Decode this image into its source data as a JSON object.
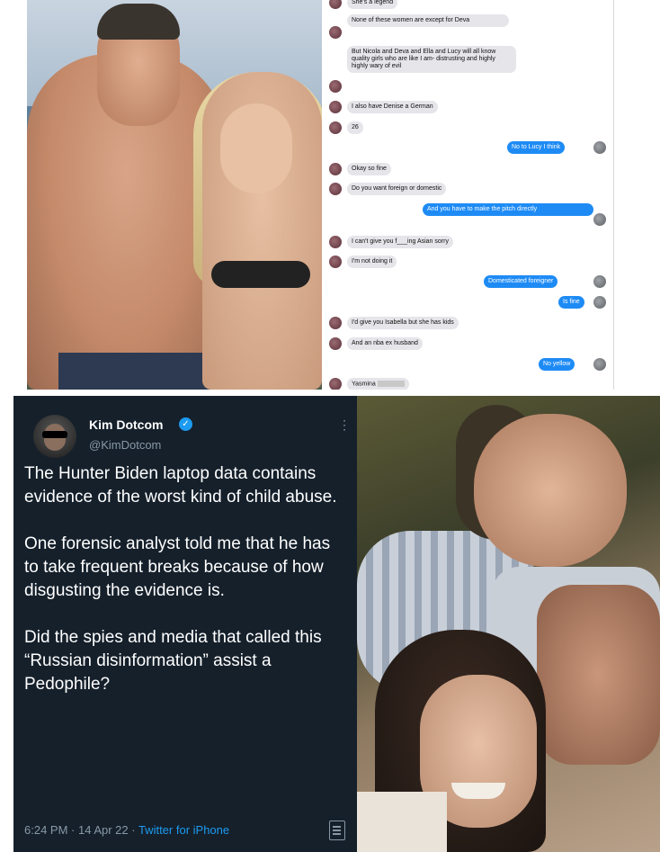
{
  "chat": {
    "messages": [
      {
        "dir": "in",
        "text": "She's a legend"
      },
      {
        "dir": "in",
        "text": "None of these women are except for Deva"
      },
      {
        "dir": "in",
        "text": "But Nicola and Deva and Ella and Lucy will all know quality girls who are like I am- distrusting and highly highly wary of evil"
      },
      {
        "dir": "in",
        "text": "I also have Denise a German"
      },
      {
        "dir": "in",
        "text": "26"
      },
      {
        "dir": "out",
        "text": "No to Lucy I think"
      },
      {
        "dir": "in",
        "text": "Okay so fine"
      },
      {
        "dir": "in",
        "text": "Do you want foreign or domestic"
      },
      {
        "dir": "out",
        "text": "And you have to make the pitch directly"
      },
      {
        "dir": "in",
        "text": "I can't give you f___ing Asian sorry"
      },
      {
        "dir": "in",
        "text": "I'm not doing it"
      },
      {
        "dir": "out",
        "text": "Domesticated foreigner"
      },
      {
        "dir": "out",
        "text": "Is fine"
      },
      {
        "dir": "in",
        "text": "I'd give you Isabella but she has kids"
      },
      {
        "dir": "in",
        "text": "And an nba ex husband"
      },
      {
        "dir": "out",
        "text": "No yellow"
      },
      {
        "dir": "in",
        "text": "Yasmina"
      }
    ]
  },
  "tweet": {
    "name": "Kim Dotcom",
    "verified_glyph": "✓",
    "handle": "@KimDotcom",
    "more_glyph": "⋮",
    "body": "The Hunter Biden laptop data contains evidence of the worst kind of child abuse.\n\nOne forensic analyst told me that he has to take frequent breaks because of how disgusting the evidence is.\n\nDid the spies and media that called this “Russian disinformation” assist a Pedophile?",
    "time": "6:24 PM · 14 Apr 22 · ",
    "source": "Twitter for iPhone",
    "colors": {
      "background": "#15202b",
      "text": "#ffffff",
      "muted": "#8899a6",
      "accent": "#1d9bf0"
    }
  },
  "icons": {
    "verified": "verified-badge-icon",
    "more": "more-options-icon",
    "analytics": "tweet-analytics-icon"
  },
  "chat_colors": {
    "incoming": "#e5e5ea",
    "outgoing": "#1e8bf5"
  }
}
